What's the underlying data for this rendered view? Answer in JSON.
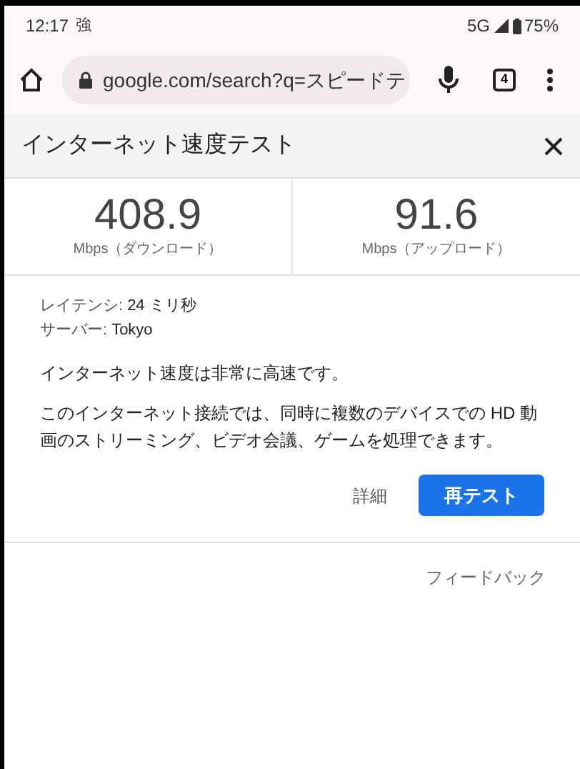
{
  "status_bar": {
    "time": "12:17",
    "carrier_mark": "強",
    "network": "5G",
    "battery": "75%"
  },
  "browser": {
    "url": "google.com/search?q=スピードテ",
    "tab_count": "4"
  },
  "card": {
    "title": "インターネット速度テスト",
    "results": [
      {
        "value": "408.9",
        "unit": "Mbps（ダウンロード）"
      },
      {
        "value": "91.6",
        "unit": "Mbps（アップロード）"
      }
    ],
    "details": [
      {
        "label": "レイテンシ:",
        "value": "24 ミリ秒"
      },
      {
        "label": "サーバー:",
        "value": "Tokyo"
      }
    ],
    "verdict": "インターネット速度は非常に高速です。",
    "description": "このインターネット接続では、同時に複数のデバイスでの HD 動画のストリーミング、ビデオ会議、ゲームを処理できます。",
    "details_link": "詳細",
    "retest_button": "再テスト",
    "feedback": "フィードバック"
  }
}
